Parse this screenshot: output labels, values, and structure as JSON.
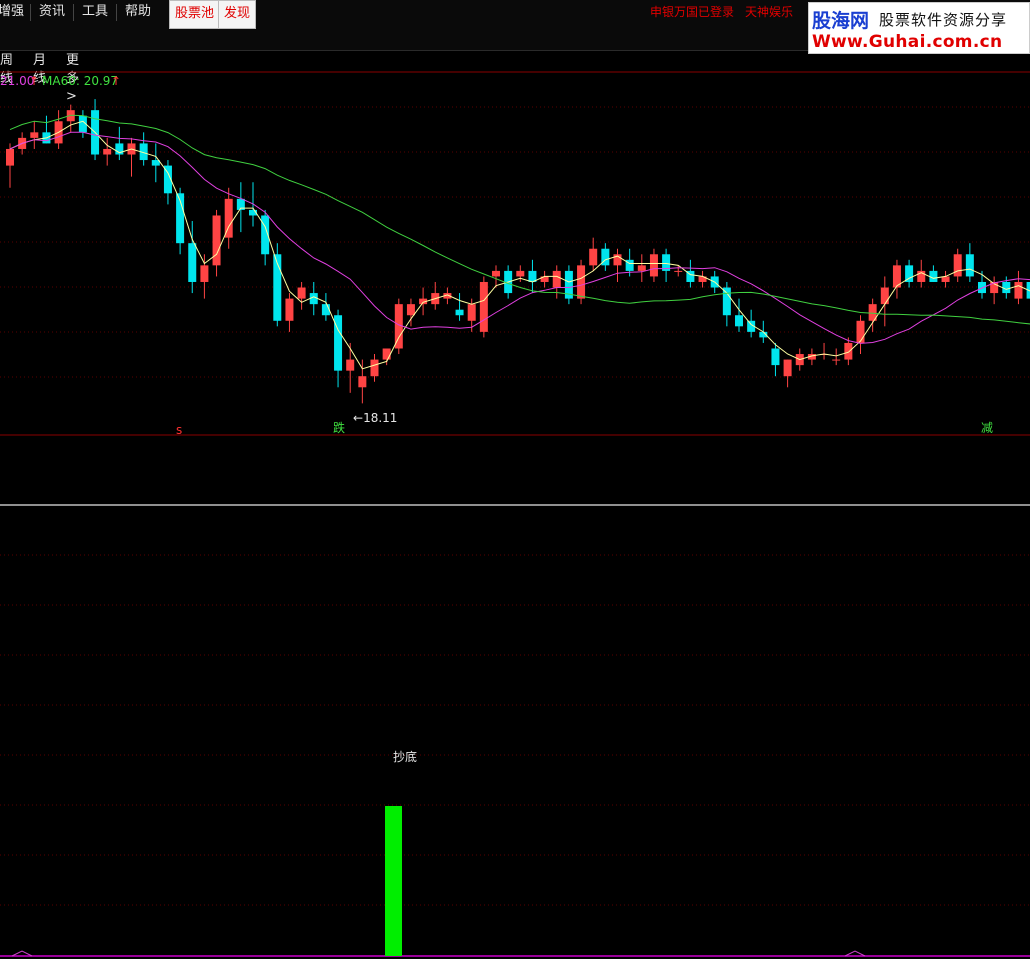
{
  "menu": {
    "items": [
      "增强",
      "资讯",
      "工具",
      "帮助"
    ],
    "highlight_buttons": [
      "股票池",
      "发现"
    ],
    "notices": [
      "申银万国已登录",
      "天神娱乐"
    ]
  },
  "logo": {
    "name": "股海网",
    "slogan": "股票软件资源分享",
    "url": "Www.Guhai.com.cn"
  },
  "tabs": [
    "周线",
    "月线",
    "更多 >"
  ],
  "ma_labels": [
    {
      "text": "21.00",
      "color": "#e040e0"
    },
    {
      "text": "MA60: 20.97",
      "color": "#40e040"
    }
  ],
  "annotations": {
    "low_price": "18.11",
    "signal_s": "s",
    "signal_die": "跌",
    "signal_jian": "减",
    "indicator_label": "抄底"
  },
  "colors": {
    "up": "#ff4444",
    "down": "#00e5ee",
    "ma_short": "#ffffa0",
    "ma_mid": "#e040e0",
    "ma60": "#40d040",
    "signal_bar": "#00ee00",
    "grid": "#5a0000"
  },
  "chart_data": {
    "type": "candlestick",
    "low_value": 18.11,
    "indicator": {
      "type": "bar",
      "signal_index": 29,
      "label": "抄底"
    },
    "candles": [
      [
        22.4,
        22.8,
        22.0,
        22.7
      ],
      [
        22.7,
        23.0,
        22.6,
        22.9
      ],
      [
        22.9,
        23.2,
        22.7,
        23.0
      ],
      [
        23.0,
        23.3,
        22.8,
        22.8
      ],
      [
        22.8,
        23.4,
        22.7,
        23.2
      ],
      [
        23.2,
        23.5,
        23.0,
        23.4
      ],
      [
        23.3,
        23.4,
        22.9,
        23.0
      ],
      [
        23.4,
        23.6,
        22.5,
        22.6
      ],
      [
        22.6,
        22.9,
        22.4,
        22.7
      ],
      [
        22.8,
        23.1,
        22.5,
        22.6
      ],
      [
        22.6,
        22.9,
        22.2,
        22.8
      ],
      [
        22.8,
        23.0,
        22.4,
        22.5
      ],
      [
        22.5,
        22.8,
        22.1,
        22.4
      ],
      [
        22.4,
        22.5,
        21.7,
        21.9
      ],
      [
        21.9,
        22.0,
        20.8,
        21.0
      ],
      [
        21.0,
        21.4,
        20.1,
        20.3
      ],
      [
        20.3,
        20.8,
        20.0,
        20.6
      ],
      [
        20.6,
        21.6,
        20.4,
        21.5
      ],
      [
        21.1,
        22.0,
        20.9,
        21.8
      ],
      [
        21.8,
        22.1,
        21.2,
        21.6
      ],
      [
        21.6,
        22.1,
        21.3,
        21.5
      ],
      [
        21.5,
        21.6,
        20.6,
        20.8
      ],
      [
        20.8,
        21.0,
        19.5,
        19.6
      ],
      [
        19.6,
        20.1,
        19.4,
        20.0
      ],
      [
        20.0,
        20.3,
        19.8,
        20.2
      ],
      [
        20.1,
        20.3,
        19.7,
        19.9
      ],
      [
        19.9,
        20.1,
        19.6,
        19.7
      ],
      [
        19.7,
        19.8,
        18.4,
        18.7
      ],
      [
        18.7,
        19.2,
        18.3,
        18.9
      ],
      [
        18.4,
        18.9,
        18.11,
        18.6
      ],
      [
        18.6,
        19.0,
        18.5,
        18.9
      ],
      [
        18.9,
        19.1,
        18.8,
        19.1
      ],
      [
        19.1,
        20.0,
        19.0,
        19.9
      ],
      [
        19.7,
        20.0,
        19.5,
        19.9
      ],
      [
        19.9,
        20.2,
        19.7,
        20.0
      ],
      [
        19.9,
        20.3,
        19.8,
        20.1
      ],
      [
        20.0,
        20.2,
        19.9,
        20.1
      ],
      [
        19.8,
        20.1,
        19.6,
        19.7
      ],
      [
        19.6,
        20.0,
        19.4,
        19.9
      ],
      [
        19.4,
        20.4,
        19.3,
        20.3
      ],
      [
        20.4,
        20.6,
        20.2,
        20.5
      ],
      [
        20.5,
        20.6,
        20.0,
        20.1
      ],
      [
        20.4,
        20.6,
        20.3,
        20.5
      ],
      [
        20.5,
        20.7,
        20.1,
        20.3
      ],
      [
        20.3,
        20.5,
        20.2,
        20.4
      ],
      [
        20.2,
        20.6,
        20.0,
        20.5
      ],
      [
        20.5,
        20.6,
        19.9,
        20.0
      ],
      [
        20.0,
        20.7,
        19.9,
        20.6
      ],
      [
        20.6,
        21.1,
        20.5,
        20.9
      ],
      [
        20.9,
        21.0,
        20.5,
        20.6
      ],
      [
        20.6,
        20.9,
        20.3,
        20.8
      ],
      [
        20.7,
        20.9,
        20.4,
        20.5
      ],
      [
        20.5,
        20.8,
        20.3,
        20.6
      ],
      [
        20.4,
        20.9,
        20.3,
        20.8
      ],
      [
        20.8,
        20.9,
        20.3,
        20.5
      ],
      [
        20.5,
        20.6,
        20.4,
        20.5
      ],
      [
        20.5,
        20.7,
        20.2,
        20.3
      ],
      [
        20.3,
        20.5,
        20.2,
        20.4
      ],
      [
        20.4,
        20.5,
        20.1,
        20.2
      ],
      [
        20.2,
        20.3,
        19.5,
        19.7
      ],
      [
        19.7,
        20.0,
        19.4,
        19.5
      ],
      [
        19.6,
        19.8,
        19.3,
        19.4
      ],
      [
        19.4,
        19.6,
        19.2,
        19.3
      ],
      [
        19.1,
        19.2,
        18.6,
        18.8
      ],
      [
        18.6,
        18.9,
        18.4,
        18.9
      ],
      [
        18.8,
        19.1,
        18.7,
        19.0
      ],
      [
        18.9,
        19.1,
        18.8,
        19.0
      ],
      [
        19.0,
        19.2,
        18.9,
        19.0
      ],
      [
        18.9,
        19.1,
        18.8,
        18.9
      ],
      [
        18.9,
        19.3,
        18.8,
        19.2
      ],
      [
        19.2,
        19.7,
        19.0,
        19.6
      ],
      [
        19.6,
        20.0,
        19.4,
        19.9
      ],
      [
        19.9,
        20.4,
        19.5,
        20.2
      ],
      [
        20.2,
        20.7,
        20.0,
        20.6
      ],
      [
        20.6,
        20.7,
        20.2,
        20.3
      ],
      [
        20.3,
        20.7,
        20.2,
        20.5
      ],
      [
        20.5,
        20.6,
        20.3,
        20.3
      ],
      [
        20.3,
        20.5,
        20.2,
        20.4
      ],
      [
        20.4,
        20.9,
        20.3,
        20.8
      ],
      [
        20.8,
        21.0,
        20.3,
        20.4
      ],
      [
        20.3,
        20.5,
        20.0,
        20.1
      ],
      [
        20.1,
        20.4,
        19.9,
        20.3
      ],
      [
        20.3,
        20.4,
        20.0,
        20.1
      ],
      [
        20.0,
        20.5,
        19.9,
        20.3
      ],
      [
        20.3,
        20.6,
        19.8,
        20.0
      ],
      [
        20.1,
        21.1,
        19.9,
        20.7
      ],
      [
        20.7,
        21.2,
        20.5,
        21.0
      ]
    ]
  }
}
